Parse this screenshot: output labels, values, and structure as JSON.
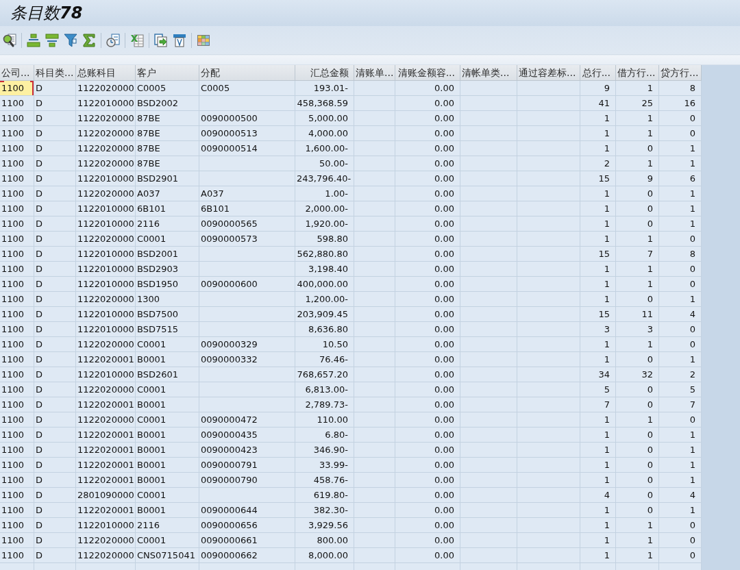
{
  "window": {
    "title": "条目数**78**"
  },
  "table": {
    "columns": [
      {
        "label": "公司...",
        "kind": "text"
      },
      {
        "label": "科目类...",
        "kind": "text"
      },
      {
        "label": "总账科目",
        "kind": "text"
      },
      {
        "label": "客户",
        "kind": "text"
      },
      {
        "label": "分配",
        "kind": "text"
      },
      {
        "label": "汇总金额",
        "kind": "number"
      },
      {
        "label": "清账单...",
        "kind": "text"
      },
      {
        "label": "清账金额容...",
        "kind": "number"
      },
      {
        "label": "清帐单类...",
        "kind": "text"
      },
      {
        "label": "通过容差标...",
        "kind": "text"
      },
      {
        "label": "总行...",
        "kind": "number"
      },
      {
        "label": "借方行...",
        "kind": "number"
      },
      {
        "label": "贷方行...",
        "kind": "number"
      }
    ],
    "rows": [
      {
        "selected": true,
        "cells": [
          "1100",
          "D",
          "1122020000",
          "C0005",
          "C0005",
          "193.01-",
          null,
          "0.00",
          null,
          null,
          "9",
          "1",
          "8"
        ]
      },
      {
        "selected": false,
        "cells": [
          "1100",
          "D",
          "1122010000",
          "BSD2002",
          null,
          "458,368.59",
          null,
          "0.00",
          null,
          null,
          "41",
          "25",
          "16"
        ]
      },
      {
        "selected": false,
        "cells": [
          "1100",
          "D",
          "1122020000",
          "87BE",
          "0090000500",
          "5,000.00",
          null,
          "0.00",
          null,
          null,
          "1",
          "1",
          "0"
        ]
      },
      {
        "selected": false,
        "cells": [
          "1100",
          "D",
          "1122020000",
          "87BE",
          "0090000513",
          "4,000.00",
          null,
          "0.00",
          null,
          null,
          "1",
          "1",
          "0"
        ]
      },
      {
        "selected": false,
        "cells": [
          "1100",
          "D",
          "1122020000",
          "87BE",
          "0090000514",
          "1,600.00-",
          null,
          "0.00",
          null,
          null,
          "1",
          "0",
          "1"
        ]
      },
      {
        "selected": false,
        "cells": [
          "1100",
          "D",
          "1122020000",
          "87BE",
          null,
          "50.00-",
          null,
          "0.00",
          null,
          null,
          "2",
          "1",
          "1"
        ]
      },
      {
        "selected": false,
        "cells": [
          "1100",
          "D",
          "1122010000",
          "BSD2901",
          null,
          "243,796.40-",
          null,
          "0.00",
          null,
          null,
          "15",
          "9",
          "6"
        ]
      },
      {
        "selected": false,
        "cells": [
          "1100",
          "D",
          "1122020000",
          "A037",
          "A037",
          "1.00-",
          null,
          "0.00",
          null,
          null,
          "1",
          "0",
          "1"
        ]
      },
      {
        "selected": false,
        "cells": [
          "1100",
          "D",
          "1122010000",
          "6B101",
          "6B101",
          "2,000.00-",
          null,
          "0.00",
          null,
          null,
          "1",
          "0",
          "1"
        ]
      },
      {
        "selected": false,
        "cells": [
          "1100",
          "D",
          "1122010000",
          "2116",
          "0090000565",
          "1,920.00-",
          null,
          "0.00",
          null,
          null,
          "1",
          "0",
          "1"
        ]
      },
      {
        "selected": false,
        "cells": [
          "1100",
          "D",
          "1122020000",
          "C0001",
          "0090000573",
          "598.80",
          null,
          "0.00",
          null,
          null,
          "1",
          "1",
          "0"
        ]
      },
      {
        "selected": false,
        "cells": [
          "1100",
          "D",
          "1122010000",
          "BSD2001",
          null,
          "562,880.80",
          null,
          "0.00",
          null,
          null,
          "15",
          "7",
          "8"
        ]
      },
      {
        "selected": false,
        "cells": [
          "1100",
          "D",
          "1122010000",
          "BSD2903",
          null,
          "3,198.40",
          null,
          "0.00",
          null,
          null,
          "1",
          "1",
          "0"
        ]
      },
      {
        "selected": false,
        "cells": [
          "1100",
          "D",
          "1122010000",
          "BSD1950",
          "0090000600",
          "400,000.00",
          null,
          "0.00",
          null,
          null,
          "1",
          "1",
          "0"
        ]
      },
      {
        "selected": false,
        "cells": [
          "1100",
          "D",
          "1122020000",
          "1300",
          null,
          "1,200.00-",
          null,
          "0.00",
          null,
          null,
          "1",
          "0",
          "1"
        ]
      },
      {
        "selected": false,
        "cells": [
          "1100",
          "D",
          "1122010000",
          "BSD7500",
          null,
          "203,909.45",
          null,
          "0.00",
          null,
          null,
          "15",
          "11",
          "4"
        ]
      },
      {
        "selected": false,
        "cells": [
          "1100",
          "D",
          "1122010000",
          "BSD7515",
          null,
          "8,636.80",
          null,
          "0.00",
          null,
          null,
          "3",
          "3",
          "0"
        ]
      },
      {
        "selected": false,
        "cells": [
          "1100",
          "D",
          "1122020000",
          "C0001",
          "0090000329",
          "10.50",
          null,
          "0.00",
          null,
          null,
          "1",
          "1",
          "0"
        ]
      },
      {
        "selected": false,
        "cells": [
          "1100",
          "D",
          "1122020001",
          "B0001",
          "0090000332",
          "76.46-",
          null,
          "0.00",
          null,
          null,
          "1",
          "0",
          "1"
        ]
      },
      {
        "selected": false,
        "cells": [
          "1100",
          "D",
          "1122010000",
          "BSD2601",
          null,
          "768,657.20",
          null,
          "0.00",
          null,
          null,
          "34",
          "32",
          "2"
        ]
      },
      {
        "selected": false,
        "cells": [
          "1100",
          "D",
          "1122020000",
          "C0001",
          null,
          "6,813.00-",
          null,
          "0.00",
          null,
          null,
          "5",
          "0",
          "5"
        ]
      },
      {
        "selected": false,
        "cells": [
          "1100",
          "D",
          "1122020001",
          "B0001",
          null,
          "2,789.73-",
          null,
          "0.00",
          null,
          null,
          "7",
          "0",
          "7"
        ]
      },
      {
        "selected": false,
        "cells": [
          "1100",
          "D",
          "1122020000",
          "C0001",
          "0090000472",
          "110.00",
          null,
          "0.00",
          null,
          null,
          "1",
          "1",
          "0"
        ]
      },
      {
        "selected": false,
        "cells": [
          "1100",
          "D",
          "1122020001",
          "B0001",
          "0090000435",
          "6.80-",
          null,
          "0.00",
          null,
          null,
          "1",
          "0",
          "1"
        ]
      },
      {
        "selected": false,
        "cells": [
          "1100",
          "D",
          "1122020001",
          "B0001",
          "0090000423",
          "346.90-",
          null,
          "0.00",
          null,
          null,
          "1",
          "0",
          "1"
        ]
      },
      {
        "selected": false,
        "cells": [
          "1100",
          "D",
          "1122020001",
          "B0001",
          "0090000791",
          "33.99-",
          null,
          "0.00",
          null,
          null,
          "1",
          "0",
          "1"
        ]
      },
      {
        "selected": false,
        "cells": [
          "1100",
          "D",
          "1122020001",
          "B0001",
          "0090000790",
          "458.76-",
          null,
          "0.00",
          null,
          null,
          "1",
          "0",
          "1"
        ]
      },
      {
        "selected": false,
        "cells": [
          "1100",
          "D",
          "2801090000",
          "C0001",
          null,
          "619.80-",
          null,
          "0.00",
          null,
          null,
          "4",
          "0",
          "4"
        ]
      },
      {
        "selected": false,
        "cells": [
          "1100",
          "D",
          "1122020001",
          "B0001",
          "0090000644",
          "382.30-",
          null,
          "0.00",
          null,
          null,
          "1",
          "0",
          "1"
        ]
      },
      {
        "selected": false,
        "cells": [
          "1100",
          "D",
          "1122010000",
          "2116",
          "0090000656",
          "3,929.56",
          null,
          "0.00",
          null,
          null,
          "1",
          "1",
          "0"
        ]
      },
      {
        "selected": false,
        "cells": [
          "1100",
          "D",
          "1122020000",
          "C0001",
          "0090000661",
          "800.00",
          null,
          "0.00",
          null,
          null,
          "1",
          "1",
          "0"
        ]
      },
      {
        "selected": false,
        "cells": [
          "1100",
          "D",
          "1122020000",
          "CNS0715041",
          "0090000662",
          "8,000.00",
          null,
          "0.00",
          null,
          null,
          "1",
          "1",
          "0"
        ]
      }
    ]
  }
}
